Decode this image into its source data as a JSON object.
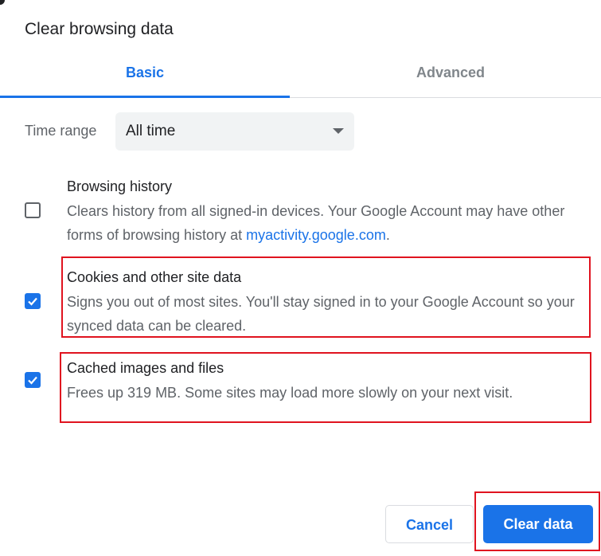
{
  "dialog": {
    "title": "Clear browsing data",
    "tabs": [
      {
        "label": "Basic",
        "active": true
      },
      {
        "label": "Advanced",
        "active": false
      }
    ],
    "time_range": {
      "label": "Time range",
      "value": "All time"
    },
    "items": [
      {
        "title": "Browsing history",
        "checked": false,
        "desc_prefix": "Clears history from all signed-in devices. Your Google Account may have other forms of browsing history at ",
        "link": "myactivity.google.com",
        "desc_suffix": "."
      },
      {
        "title": "Cookies and other site data",
        "checked": true,
        "desc": "Signs you out of most sites. You'll stay signed in to your Google Account so your synced data can be cleared."
      },
      {
        "title": "Cached images and files",
        "checked": true,
        "desc": "Frees up 319 MB. Some sites may load more slowly on your next visit."
      }
    ],
    "buttons": {
      "cancel": "Cancel",
      "clear": "Clear data"
    },
    "colors": {
      "accent": "#1a73e8",
      "highlight": "#e0131f"
    }
  }
}
